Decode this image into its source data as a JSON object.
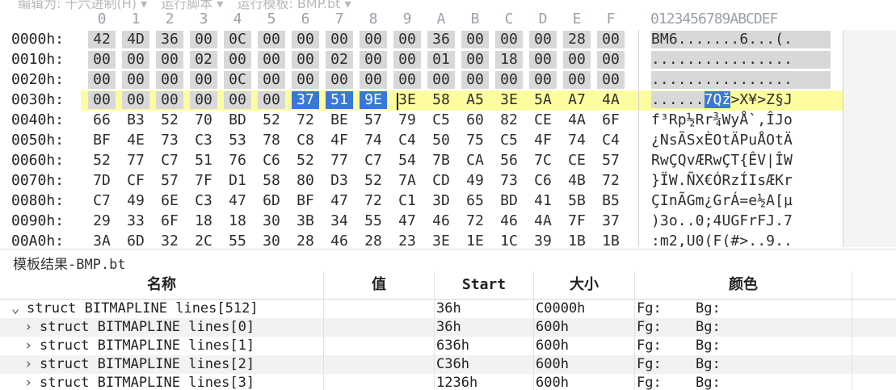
{
  "menubar": {
    "items": [
      "编辑为: 十六进制(H) ▾",
      "运行脚本 ▾",
      "运行模板: BMP.bt ▾"
    ]
  },
  "hex_header": {
    "columns": [
      "0",
      "1",
      "2",
      "3",
      "4",
      "5",
      "6",
      "7",
      "8",
      "9",
      "A",
      "B",
      "C",
      "D",
      "E",
      "F"
    ],
    "ascii_header": "0123456789ABCDEF"
  },
  "hex_rows": [
    {
      "addr": "0000h:",
      "bytes": [
        "42",
        "4D",
        "36",
        "00",
        "0C",
        "00",
        "00",
        "00",
        "00",
        "00",
        "36",
        "00",
        "00",
        "00",
        "28",
        "00"
      ],
      "ascii": "BM6.......6...(."
    },
    {
      "addr": "0010h:",
      "bytes": [
        "00",
        "00",
        "00",
        "02",
        "00",
        "00",
        "00",
        "02",
        "00",
        "00",
        "01",
        "00",
        "18",
        "00",
        "00",
        "00"
      ],
      "ascii": "................"
    },
    {
      "addr": "0020h:",
      "bytes": [
        "00",
        "00",
        "00",
        "00",
        "0C",
        "00",
        "00",
        "00",
        "00",
        "00",
        "00",
        "00",
        "00",
        "00",
        "00",
        "00"
      ],
      "ascii": "................"
    },
    {
      "addr": "0030h:",
      "bytes": [
        "00",
        "00",
        "00",
        "00",
        "00",
        "00",
        "37",
        "51",
        "9E",
        "3E",
        "58",
        "A5",
        "3E",
        "5A",
        "A7",
        "4A"
      ],
      "ascii": "......7Qž>X¥>Z§J"
    },
    {
      "addr": "0040h:",
      "bytes": [
        "66",
        "B3",
        "52",
        "70",
        "BD",
        "52",
        "72",
        "BE",
        "57",
        "79",
        "C5",
        "60",
        "82",
        "CE",
        "4A",
        "6F"
      ],
      "ascii": "f³Rp½Rr¾WyÅ`‚ÎJo"
    },
    {
      "addr": "0050h:",
      "bytes": [
        "BF",
        "4E",
        "73",
        "C3",
        "53",
        "78",
        "C8",
        "4F",
        "74",
        "C4",
        "50",
        "75",
        "C5",
        "4F",
        "74",
        "C4"
      ],
      "ascii": "¿NsÃSxÈOtÄPuÅOtÄ"
    },
    {
      "addr": "0060h:",
      "bytes": [
        "52",
        "77",
        "C7",
        "51",
        "76",
        "C6",
        "52",
        "77",
        "C7",
        "54",
        "7B",
        "CA",
        "56",
        "7C",
        "CE",
        "57"
      ],
      "ascii": "RwÇQvÆRwÇT{ÊV|ÎW"
    },
    {
      "addr": "0070h:",
      "bytes": [
        "7D",
        "CF",
        "57",
        "7F",
        "D1",
        "58",
        "80",
        "D3",
        "52",
        "7A",
        "CD",
        "49",
        "73",
        "C6",
        "4B",
        "72"
      ],
      "ascii": "}ÏW.ÑX€ÓRzÍIsÆKr"
    },
    {
      "addr": "0080h:",
      "bytes": [
        "C7",
        "49",
        "6E",
        "C3",
        "47",
        "6D",
        "BF",
        "47",
        "72",
        "C1",
        "3D",
        "65",
        "BD",
        "41",
        "5B",
        "B5"
      ],
      "ascii": "ÇInÃGm¿GrÁ=e½A[µ"
    },
    {
      "addr": "0090h:",
      "bytes": [
        "29",
        "33",
        "6F",
        "18",
        "18",
        "30",
        "3B",
        "34",
        "55",
        "47",
        "46",
        "72",
        "46",
        "4A",
        "7F",
        "37"
      ],
      "ascii": ")3o..0;4UGFrFJ.7"
    },
    {
      "addr": "00A0h:",
      "bytes": [
        "3A",
        "6D",
        "32",
        "2C",
        "55",
        "30",
        "28",
        "46",
        "28",
        "23",
        "3E",
        "1E",
        "1C",
        "39",
        "1B",
        "1B"
      ],
      "ascii": ":m2,U0(F(#>..9.."
    }
  ],
  "template_panel": {
    "title": "模板结果-BMP.bt",
    "columns": {
      "name": "名称",
      "value": "值",
      "start": "Start",
      "size": "大小",
      "color": "颜色"
    },
    "rows": [
      {
        "expanded": true,
        "indent": 0,
        "name": "struct BITMAPLINE lines[512]",
        "value": "",
        "start": "36h",
        "size": "C0000h",
        "fg": "Fg:",
        "bg": "Bg:"
      },
      {
        "expanded": false,
        "indent": 1,
        "name": "struct BITMAPLINE lines[0]",
        "value": "",
        "start": "36h",
        "size": "600h",
        "fg": "Fg:",
        "bg": "Bg:"
      },
      {
        "expanded": false,
        "indent": 1,
        "name": "struct BITMAPLINE lines[1]",
        "value": "",
        "start": "636h",
        "size": "600h",
        "fg": "Fg:",
        "bg": "Bg:"
      },
      {
        "expanded": false,
        "indent": 1,
        "name": "struct BITMAPLINE lines[2]",
        "value": "",
        "start": "C36h",
        "size": "600h",
        "fg": "Fg:",
        "bg": "Bg:"
      },
      {
        "expanded": false,
        "indent": 1,
        "name": "struct BITMAPLINE lines[3]",
        "value": "",
        "start": "1236h",
        "size": "600h",
        "fg": "Fg:",
        "bg": "Bg:"
      }
    ]
  },
  "colors": {
    "selection": "#3a78d8",
    "highlight_row": "#fdfc9f",
    "header_bytes": "#d8d8d8"
  }
}
